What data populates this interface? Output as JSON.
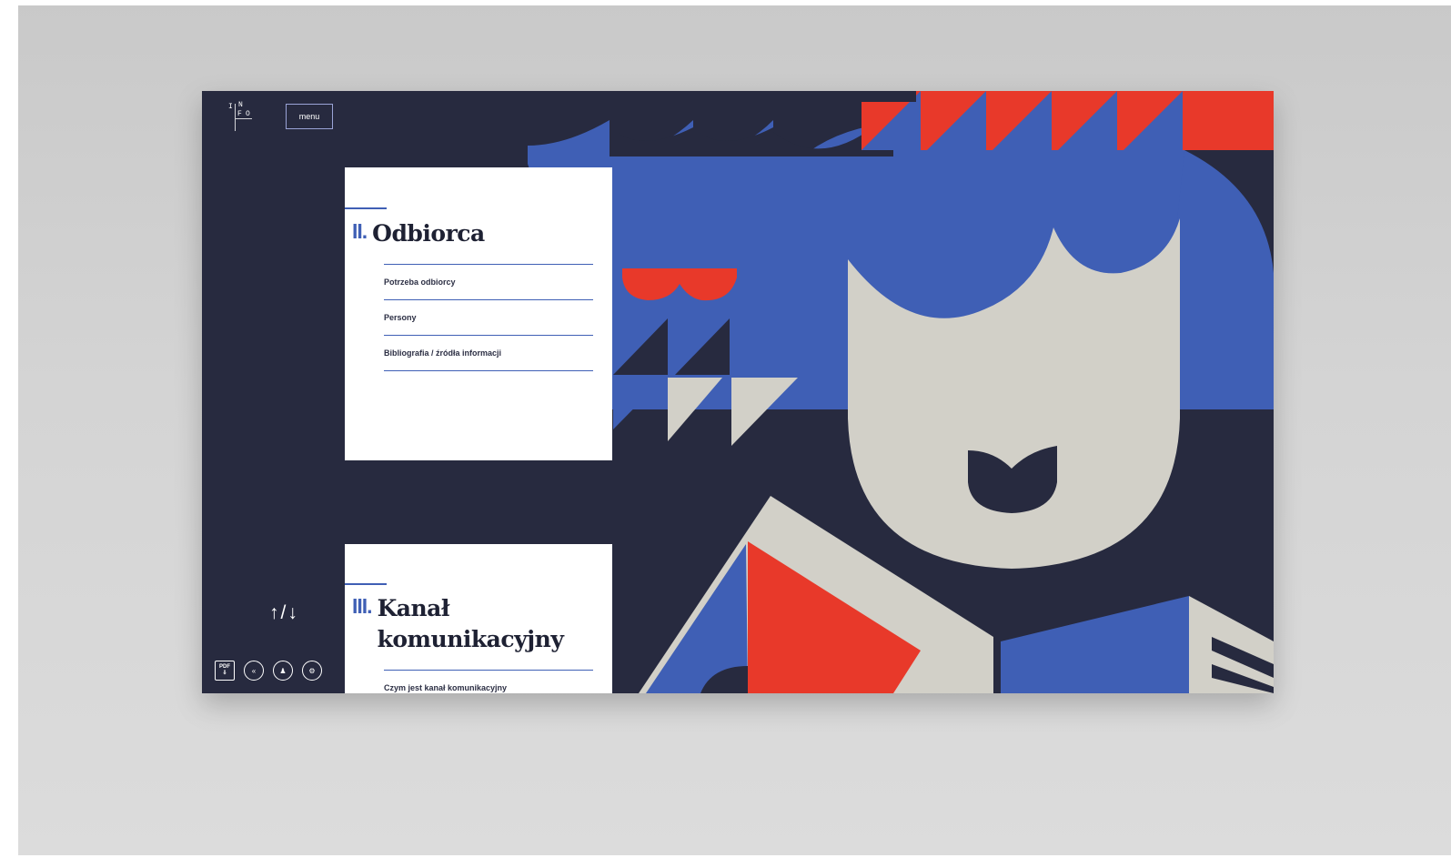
{
  "app": {
    "logo": {
      "letters": [
        "I",
        "N",
        "F",
        "O"
      ]
    },
    "menu_label": "menu"
  },
  "sections": [
    {
      "number": "II.",
      "title": "Odbiorca",
      "links": [
        "Potrzeba odbiorcy",
        "Persony",
        "Bibliografia / źródła informacji"
      ]
    },
    {
      "number": "III.",
      "title_line1": "Kanał",
      "title_line2": "komunikacyjny",
      "links": [
        "Czym jest kanał komunikacyjny"
      ]
    }
  ],
  "navigation": {
    "updown_label": "↑/↓"
  },
  "toolbar": {
    "pdf_label": "PDF",
    "icons": [
      "pdf-download-icon",
      "rewind-icon",
      "accessibility-icon",
      "settings-icon"
    ]
  },
  "colors": {
    "background_navy": "#272a3f",
    "accent_blue": "#3f5fb5",
    "accent_red": "#e8392a",
    "beige": "#d2d0c8",
    "card_white": "#ffffff",
    "backdrop_grey": "#d0d0d0"
  }
}
